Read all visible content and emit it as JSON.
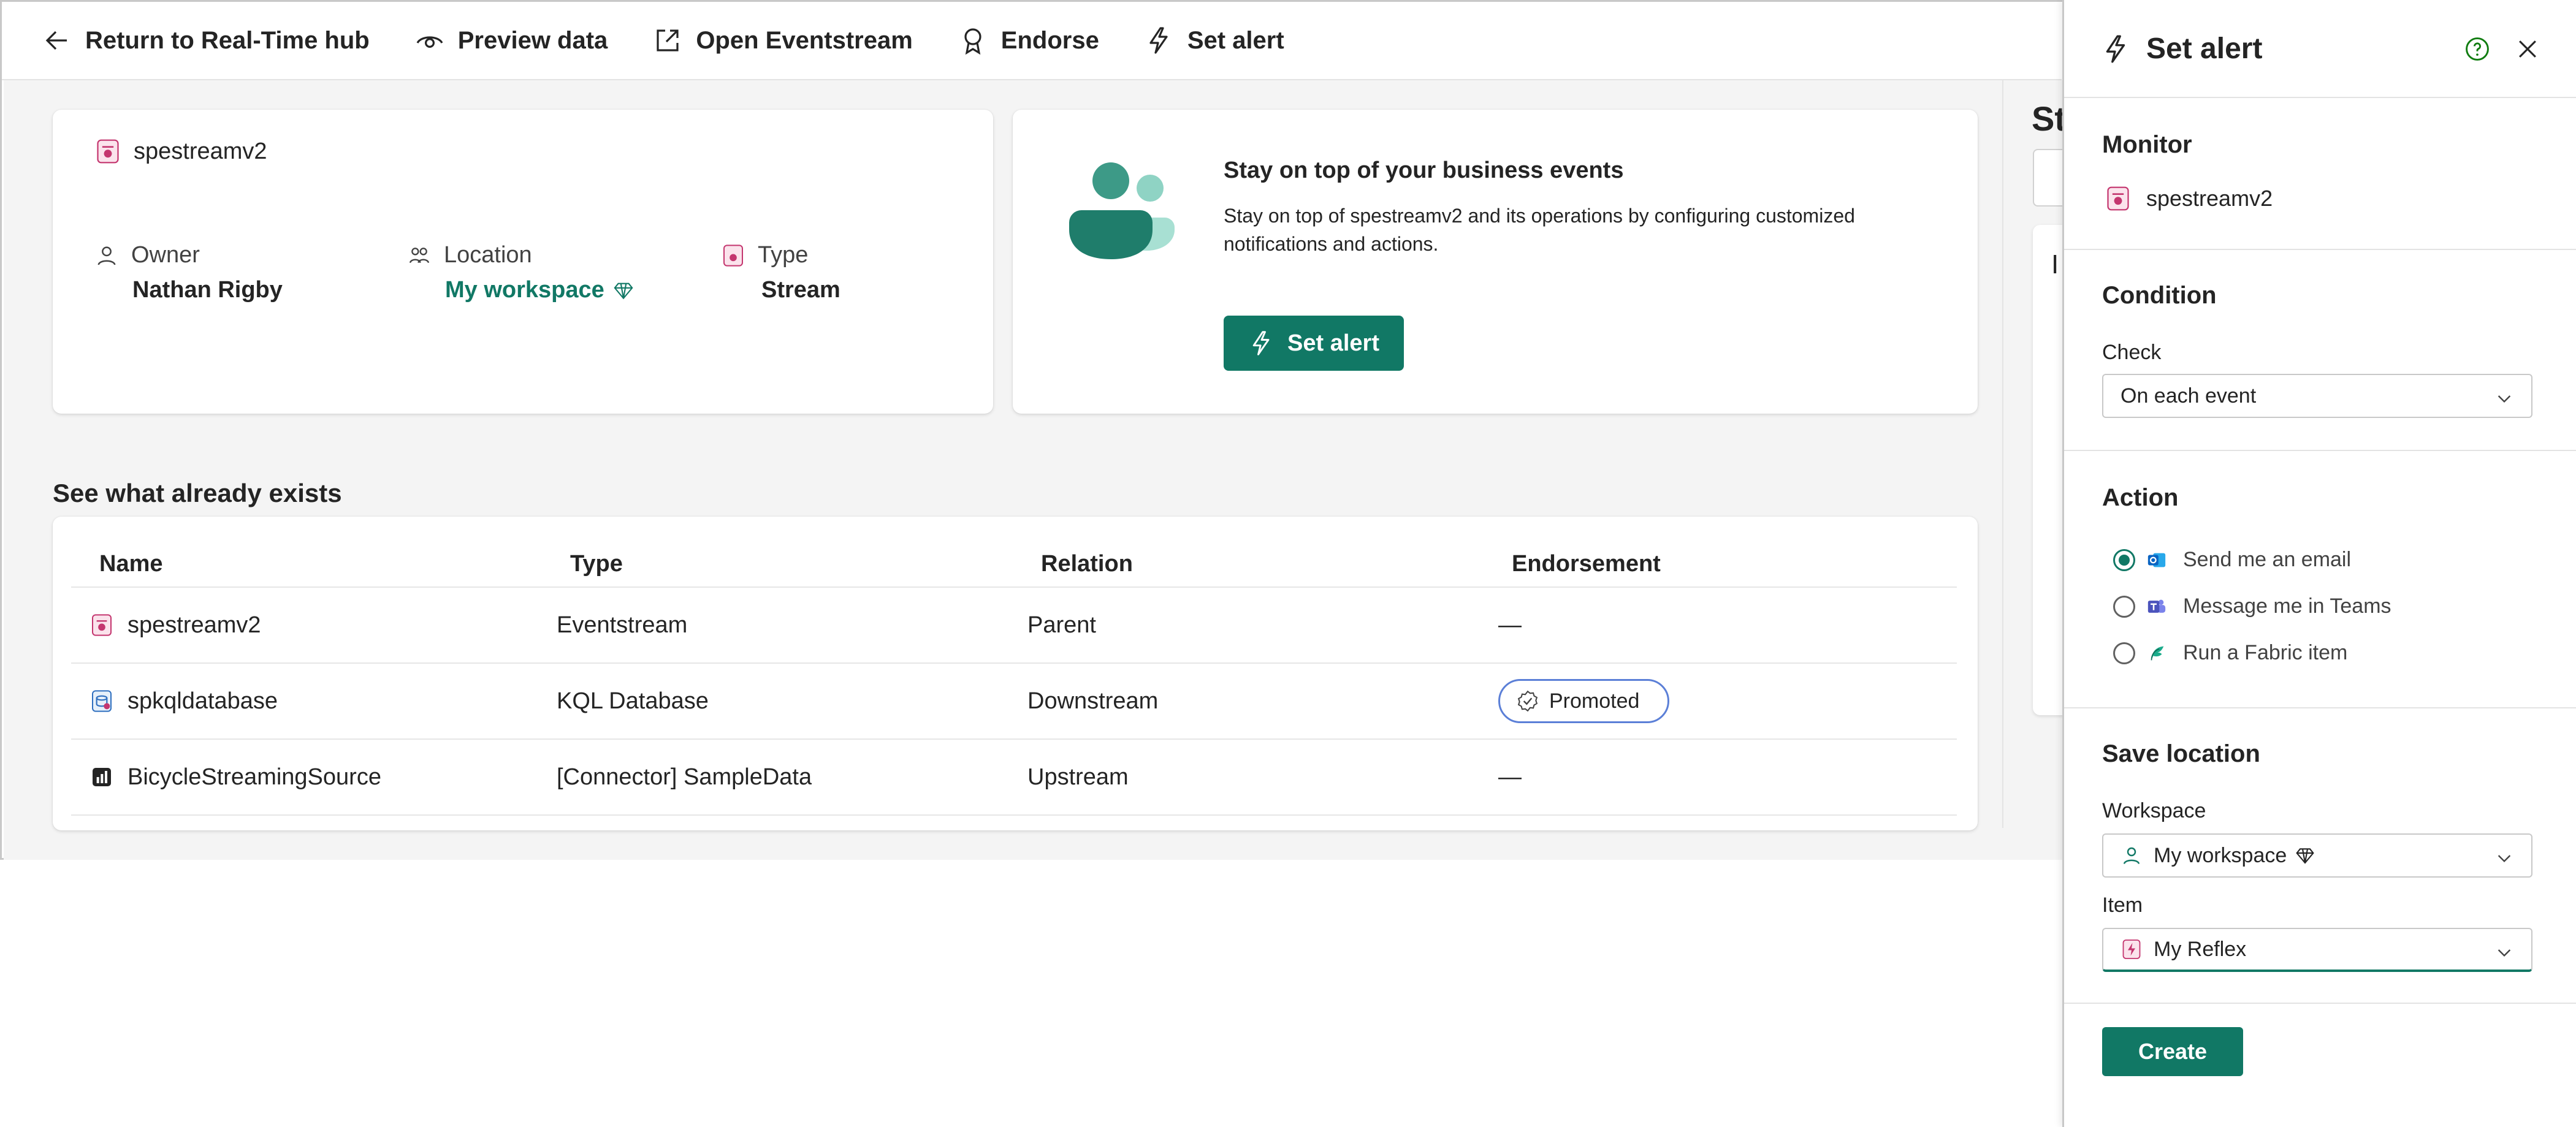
{
  "toolbar": {
    "return_label": "Return to Real-Time hub",
    "preview_label": "Preview data",
    "open_label": "Open Eventstream",
    "endorse_label": "Endorse",
    "set_alert_label": "Set alert"
  },
  "info": {
    "item_name": "spestreamv2",
    "owner_label": "Owner",
    "owner_value": "Nathan Rigby",
    "location_label": "Location",
    "location_value": "My workspace",
    "type_label": "Type",
    "type_value": "Stream"
  },
  "promo": {
    "title": "Stay on top of your business events",
    "description": "Stay on top of spestreamv2 and its operations by configuring customized notifications and actions.",
    "button_label": "Set alert"
  },
  "existing": {
    "title": "See what already exists",
    "columns": [
      "Name",
      "Type",
      "Relation",
      "Endorsement"
    ],
    "rows": [
      {
        "name": "spestreamv2",
        "type": "Eventstream",
        "relation": "Parent",
        "endorsement": "—",
        "icon": "eventstream-icon"
      },
      {
        "name": "spkqldatabase",
        "type": "KQL Database",
        "relation": "Downstream",
        "endorsement": "Promoted",
        "icon": "kql-database-icon"
      },
      {
        "name": "BicycleStreamingSource",
        "type": "[Connector] SampleData",
        "relation": "Upstream",
        "endorsement": "—",
        "icon": "connector-icon"
      }
    ]
  },
  "peek": {
    "title": "Str",
    "card_text": "I"
  },
  "panel": {
    "title": "Set alert",
    "monitor": {
      "title": "Monitor",
      "item": "spestreamv2"
    },
    "condition": {
      "title": "Condition",
      "check_label": "Check",
      "check_value": "On each event"
    },
    "action": {
      "title": "Action",
      "options": [
        "Send me an email",
        "Message me in Teams",
        "Run a Fabric item"
      ],
      "selected": 0
    },
    "save_location": {
      "title": "Save location",
      "workspace_label": "Workspace",
      "workspace_value": "My workspace",
      "item_label": "Item",
      "item_value": "My Reflex"
    },
    "create_label": "Create"
  },
  "colors": {
    "accent": "#117865",
    "eventstream": "#c4366f",
    "badge_border": "#5b7fd7"
  }
}
